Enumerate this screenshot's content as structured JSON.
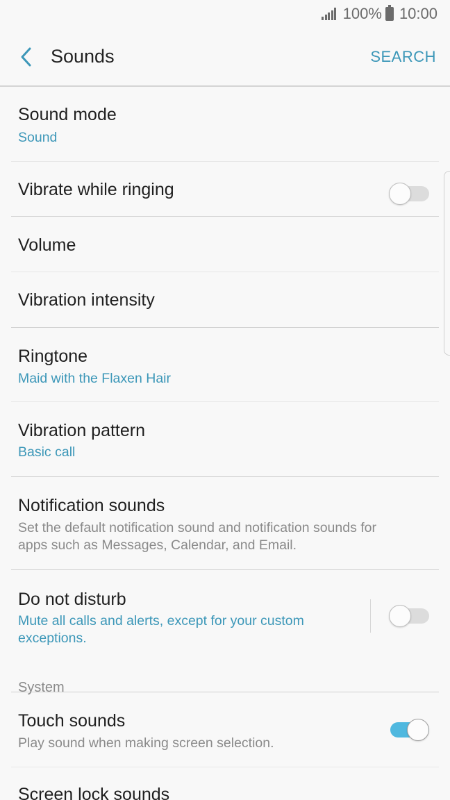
{
  "status_bar": {
    "battery": "100%",
    "time": "10:00"
  },
  "app_bar": {
    "title": "Sounds",
    "search_label": "SEARCH"
  },
  "items": [
    {
      "title": "Sound mode",
      "subtitle": "Sound"
    },
    {
      "title": "Vibrate while ringing",
      "toggle": false
    },
    {
      "title": "Volume"
    },
    {
      "title": "Vibration intensity"
    },
    {
      "title": "Ringtone",
      "subtitle": "Maid with the Flaxen Hair"
    },
    {
      "title": "Vibration pattern",
      "subtitle": "Basic call"
    },
    {
      "title": "Notification sounds",
      "description": "Set the default notification sound and notification sounds for apps such as Messages, Calendar, and Email."
    },
    {
      "title": "Do not disturb",
      "subtitle": "Mute all calls and alerts, except for your custom exceptions.",
      "toggle": false
    },
    {
      "title": "Touch sounds",
      "description": "Play sound when making screen selection.",
      "toggle": true
    },
    {
      "title": "Screen lock sounds"
    }
  ],
  "sections": {
    "system": "System"
  },
  "colors": {
    "accent": "#3c97b8",
    "toggle_on": "#4fb8df",
    "background": "#f8f8f8"
  }
}
